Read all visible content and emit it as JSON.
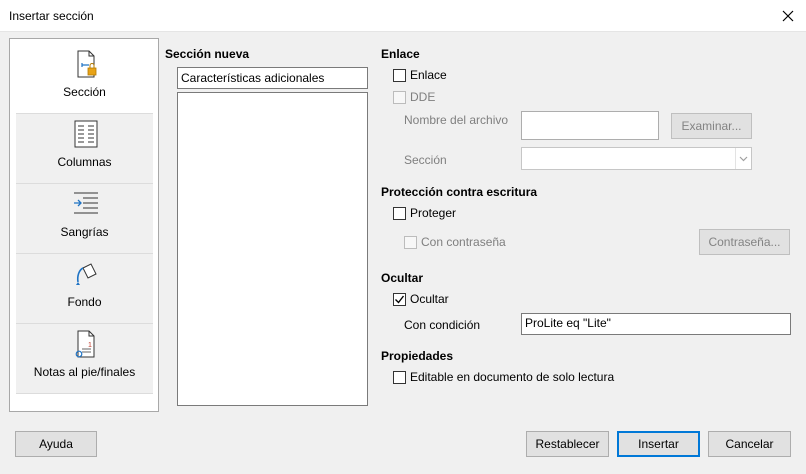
{
  "window": {
    "title": "Insertar sección"
  },
  "nav": {
    "items": [
      {
        "label": "Sección",
        "icon": "section-icon",
        "selected": true
      },
      {
        "label": "Columnas",
        "icon": "columns-icon",
        "selected": false
      },
      {
        "label": "Sangrías",
        "icon": "indents-icon",
        "selected": false
      },
      {
        "label": "Fondo",
        "icon": "background-icon",
        "selected": false
      },
      {
        "label": "Notas al pie/finales",
        "icon": "footnotes-icon",
        "selected": false
      }
    ]
  },
  "new_section": {
    "heading": "Sección nueva",
    "name_value": "Características adicionales"
  },
  "link": {
    "heading": "Enlace",
    "link_label": "Enlace",
    "link_checked": false,
    "dde_label": "DDE",
    "filename_label": "Nombre del archivo",
    "filename_value": "",
    "browse_label": "Examinar...",
    "section_label": "Sección",
    "section_value": ""
  },
  "protection": {
    "heading": "Protección contra escritura",
    "protect_label": "Proteger",
    "protect_checked": false,
    "password_label": "Con contraseña",
    "password_button": "Contraseña..."
  },
  "hide": {
    "heading": "Ocultar",
    "hide_label": "Ocultar",
    "hide_checked": true,
    "condition_label": "Con condición",
    "condition_value": "ProLite eq \"Lite\""
  },
  "properties": {
    "heading": "Propiedades",
    "editable_label": "Editable en documento de solo lectura",
    "editable_checked": false
  },
  "buttons": {
    "help": "Ayuda",
    "reset": "Restablecer",
    "insert": "Insertar",
    "cancel": "Cancelar"
  },
  "colors": {
    "accent": "#0078d7",
    "icon_blue": "#1f73c4",
    "icon_orange": "#e8a317"
  }
}
